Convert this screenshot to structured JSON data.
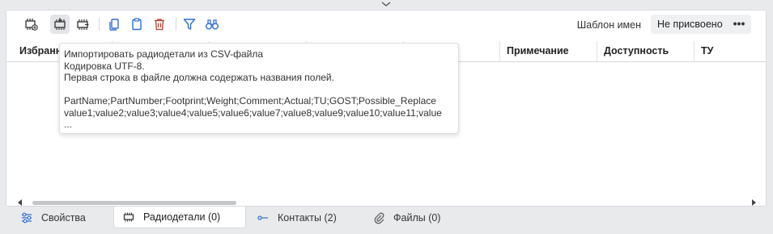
{
  "toolbar": {
    "buttons": [
      {
        "name": "add-part-icon"
      },
      {
        "name": "import-csv-icon"
      },
      {
        "name": "export-csv-icon"
      },
      {
        "name": "copy-icon"
      },
      {
        "name": "paste-icon"
      },
      {
        "name": "delete-icon"
      },
      {
        "name": "filter-icon"
      },
      {
        "name": "find-icon"
      }
    ],
    "template_label": "Шаблон имен",
    "template_value": "Не присвоено",
    "more_label": "•••"
  },
  "table": {
    "columns": [
      "Избранное",
      "",
      "",
      "",
      "",
      "Примечание",
      "Доступность",
      "ТУ"
    ]
  },
  "tooltip": {
    "lines": [
      "Импортировать радиодетали из CSV-файла",
      "Кодировка UTF-8.",
      "Первая строка в файле должна содержать названия полей.",
      "",
      "PartName;PartNumber;Footprint;Weight;Comment;Actual;TU;GOST;Possible_Replace",
      "value1;value2;value3;value4;value5;value6;value7;value8;value9;value10;value11;value",
      "..."
    ]
  },
  "tabs": [
    {
      "label": "Свойства",
      "icon": "sliders-icon"
    },
    {
      "label": "Радиодетали (0)",
      "icon": "chip-icon"
    },
    {
      "label": "Контакты (2)",
      "icon": "contact-icon"
    },
    {
      "label": "Файлы (0)",
      "icon": "paperclip-icon"
    }
  ],
  "colors": {
    "accent_blue": "#2f6fd6",
    "delete_red": "#c0392b",
    "background": "#e9eaec"
  }
}
